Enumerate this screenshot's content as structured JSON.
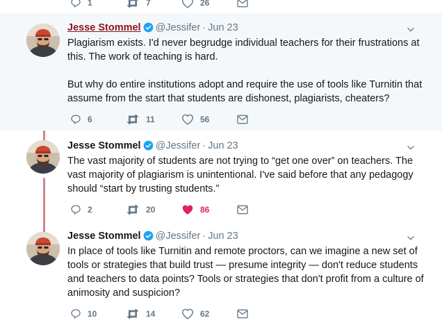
{
  "top_actions": {
    "replies": "1",
    "retweets": "7",
    "likes": "26"
  },
  "tweets": [
    {
      "name": "Jesse Stommel",
      "handle": "@Jessifer",
      "separator": "·",
      "time": "Jun 23",
      "paragraphs": [
        "Plagiarism exists. I'd never begrudge individual teachers for their frustrations at this. The work of teaching is hard.",
        "But why do entire institutions adopt and require the use of tools like Turnitin that assume from the start that students are dishonest, plagiarists, cheaters?"
      ],
      "replies": "6",
      "retweets": "11",
      "likes": "56"
    },
    {
      "name": "Jesse Stommel",
      "handle": "@Jessifer",
      "separator": "·",
      "time": "Jun 23",
      "paragraphs": [
        "The vast majority of students are not trying to “get one over” on teachers. The vast majority of plagiarism is unintentional. I've said before that any pedagogy should “start by trusting students.”"
      ],
      "replies": "2",
      "retweets": "20",
      "likes": "86"
    },
    {
      "name": "Jesse Stommel",
      "handle": "@Jessifer",
      "separator": "·",
      "time": "Jun 23",
      "paragraphs": [
        "In place of tools like Turnitin and remote proctors, can we imagine a new set of tools or strategies that build trust — presume integrity — don't reduce students and teachers to data points? Tools or strategies that don't profit from a culture of animosity and suspicion?"
      ],
      "replies": "10",
      "retweets": "14",
      "likes": "62"
    }
  ],
  "colors": {
    "thread_line": "#d2848f",
    "highlight_bg": "#f5f8fa",
    "linked_name": "#8a1620",
    "verified": "#1da1f2",
    "liked": "#e0245e",
    "muted": "#657786"
  },
  "icons": {
    "reply": "reply-icon",
    "retweet": "retweet-icon",
    "like": "heart-icon",
    "liked": "heart-filled-icon",
    "message": "envelope-icon",
    "verified": "verified-badge-icon",
    "menu": "chevron-down-icon"
  }
}
